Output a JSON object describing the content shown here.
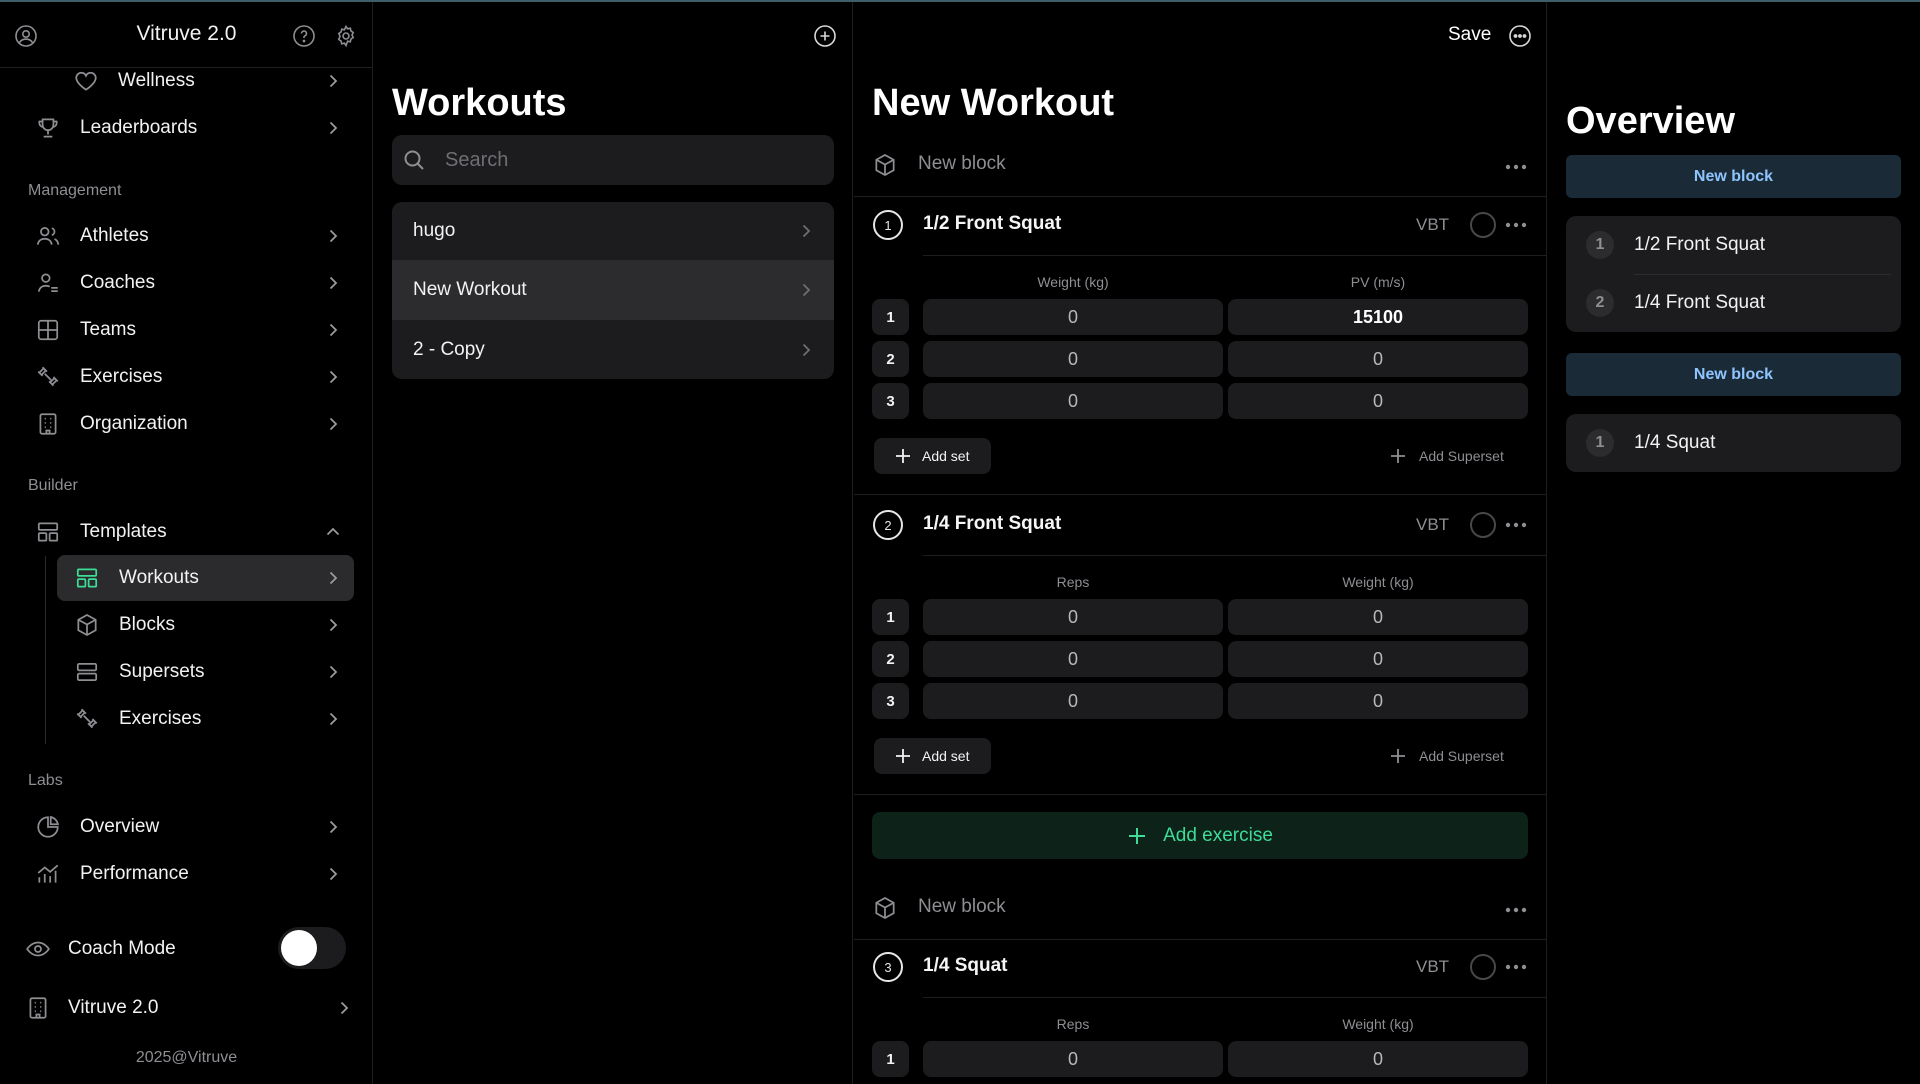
{
  "app": {
    "title": "Vitruve 2.0"
  },
  "colors": {
    "accent": "#3ddc97",
    "block_badge_bg": "#1a2a36",
    "block_badge_text": "#8ec5ff",
    "background": "#000000"
  },
  "sidebar": {
    "header_icons": [
      "user-circle-icon",
      "help-icon",
      "gear-icon"
    ],
    "items_top": [
      {
        "label": "Wellness",
        "icon": "heart-icon"
      },
      {
        "label": "Leaderboards",
        "icon": "trophy-icon"
      }
    ],
    "management_label": "Management",
    "management_items": [
      {
        "label": "Athletes",
        "icon": "users-icon"
      },
      {
        "label": "Coaches",
        "icon": "coach-icon"
      },
      {
        "label": "Teams",
        "icon": "grid-icon"
      },
      {
        "label": "Exercises",
        "icon": "exercises-icon"
      },
      {
        "label": "Organization",
        "icon": "building-icon"
      }
    ],
    "builder_label": "Builder",
    "templates_label": "Templates",
    "template_items": [
      {
        "label": "Workouts",
        "icon": "layout-icon",
        "active": true
      },
      {
        "label": "Blocks",
        "icon": "cube-icon"
      },
      {
        "label": "Supersets",
        "icon": "stack-icon"
      },
      {
        "label": "Exercises",
        "icon": "exercises-icon"
      }
    ],
    "labs_label": "Labs",
    "labs_items": [
      {
        "label": "Overview",
        "icon": "pie-chart-icon"
      },
      {
        "label": "Performance",
        "icon": "bar-chart-icon"
      }
    ],
    "coach_mode_label": "Coach Mode",
    "coach_mode_on": false,
    "org_label": "Vitruve 2.0",
    "footer": "2025@Vitruve"
  },
  "workouts": {
    "title": "Workouts",
    "search_placeholder": "Search",
    "items": [
      {
        "label": "hugo"
      },
      {
        "label": "New Workout",
        "selected": true
      },
      {
        "label": "2 - Copy"
      }
    ]
  },
  "editor": {
    "title": "New Workout",
    "save_label": "Save",
    "add_set_label": "Add set",
    "add_superset_label": "Add Superset",
    "add_exercise_label": "Add exercise",
    "vbt_label": "VBT",
    "blocks": [
      {
        "label": "New block",
        "exercises": [
          {
            "number": "1",
            "name": "1/2 Front Squat",
            "columns": [
              "Weight (kg)",
              "PV (m/s)"
            ],
            "sets": [
              {
                "num": "1",
                "a": "0",
                "b": "15100"
              },
              {
                "num": "2",
                "a": "0",
                "b": "0"
              },
              {
                "num": "3",
                "a": "0",
                "b": "0"
              }
            ]
          },
          {
            "number": "2",
            "name": "1/4 Front Squat",
            "columns": [
              "Reps",
              "Weight (kg)"
            ],
            "sets": [
              {
                "num": "1",
                "a": "0",
                "b": "0"
              },
              {
                "num": "2",
                "a": "0",
                "b": "0"
              },
              {
                "num": "3",
                "a": "0",
                "b": "0"
              }
            ]
          }
        ]
      },
      {
        "label": "New block",
        "exercises": [
          {
            "number": "3",
            "name": "1/4 Squat",
            "columns": [
              "Reps",
              "Weight (kg)"
            ],
            "sets": [
              {
                "num": "1",
                "a": "0",
                "b": "0"
              }
            ]
          }
        ]
      }
    ]
  },
  "overview": {
    "title": "Overview",
    "blocks": [
      {
        "label": "New block",
        "items": [
          {
            "num": "1",
            "name": "1/2 Front Squat"
          },
          {
            "num": "2",
            "name": "1/4 Front Squat"
          }
        ]
      },
      {
        "label": "New block",
        "items": [
          {
            "num": "1",
            "name": "1/4 Squat"
          }
        ]
      }
    ]
  }
}
